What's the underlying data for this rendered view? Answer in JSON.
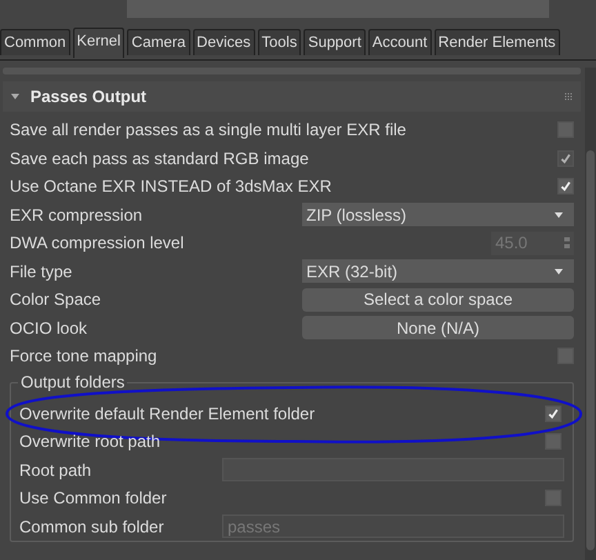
{
  "tabs": [
    {
      "label": "Common",
      "selected": false
    },
    {
      "label": "Kernel",
      "selected": true
    },
    {
      "label": "Camera",
      "selected": false
    },
    {
      "label": "Devices",
      "selected": false
    },
    {
      "label": "Tools",
      "selected": false
    },
    {
      "label": "Support",
      "selected": false
    },
    {
      "label": "Account",
      "selected": false
    },
    {
      "label": "Render Elements",
      "selected": false
    }
  ],
  "section": {
    "title": "Passes Output",
    "expanded": true,
    "rows": [
      {
        "kind": "checkbox",
        "label": "Save all render passes as a single multi layer EXR file",
        "checked": false
      },
      {
        "kind": "checkbox",
        "label": "Save each pass as standard RGB image",
        "checked": true,
        "disabled": true
      },
      {
        "kind": "checkbox",
        "label": "Use Octane EXR INSTEAD of 3dsMax EXR",
        "checked": true
      },
      {
        "kind": "dropdown",
        "label": "EXR compression",
        "value": "ZIP (lossless)",
        "disabled": false
      },
      {
        "kind": "spinner",
        "label": "DWA compression level",
        "value": "45.0",
        "disabled": true
      },
      {
        "kind": "dropdown",
        "label": "File type",
        "value": "EXR (32-bit)",
        "disabled": false
      },
      {
        "kind": "button",
        "label": "Color Space",
        "value": "Select a color space",
        "disabled": false
      },
      {
        "kind": "button",
        "label": "OCIO look",
        "value": "None (N/A)",
        "disabled": false
      },
      {
        "kind": "checkbox",
        "label": "Force tone mapping",
        "checked": false
      }
    ],
    "group": {
      "title": "Output folders",
      "rows": [
        {
          "kind": "checkbox",
          "label": "Overwrite default Render Element folder",
          "checked": true,
          "circled": true
        },
        {
          "kind": "checkbox",
          "label": "Overwrite root path",
          "checked": false
        },
        {
          "kind": "text",
          "label": "Root path",
          "disabled": false
        },
        {
          "kind": "checkbox",
          "label": "Use Common folder",
          "checked": false
        },
        {
          "kind": "text",
          "label": "Common sub folder",
          "placeholder": "passes",
          "disabled": true
        }
      ]
    }
  }
}
